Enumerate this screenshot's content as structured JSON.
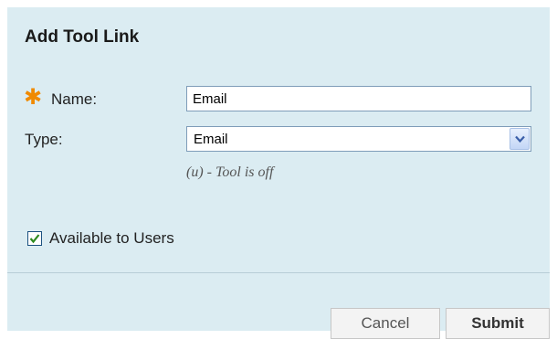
{
  "dialog": {
    "title": "Add Tool Link"
  },
  "form": {
    "name": {
      "required_marker": "✱",
      "label": "Name:",
      "value": "Email"
    },
    "type": {
      "label": "Type:",
      "selected": "Email",
      "hint": "(u) - Tool is off"
    },
    "available": {
      "label": "Available to Users",
      "checked": true
    }
  },
  "buttons": {
    "cancel_label": "Cancel",
    "submit_label": "Submit"
  },
  "icons": {
    "required": "asterisk-icon",
    "dropdown": "chevron-down-icon",
    "check": "checkmark-icon"
  },
  "colors": {
    "panel_background": "#dbecf2",
    "required_marker": "#f08a00",
    "checkmark": "#2e8b1f"
  }
}
